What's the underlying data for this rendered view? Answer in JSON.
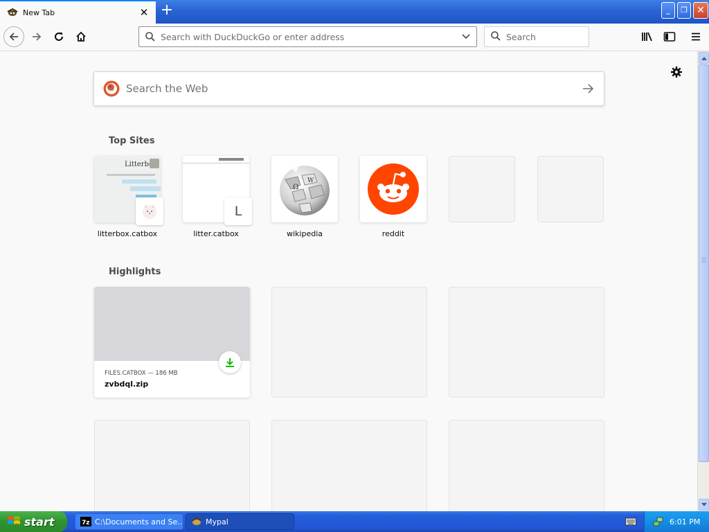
{
  "window": {
    "tab_title": "New Tab",
    "tab_close": "✕",
    "new_tab": "+",
    "minimize": "_",
    "maximize": "❐",
    "close": "✕"
  },
  "toolbar": {
    "url_placeholder": "Search with DuckDuckGo or enter address",
    "search_placeholder": "Search"
  },
  "newtab": {
    "web_search_placeholder": "Search the Web",
    "top_sites_title": "Top Sites",
    "top_sites": [
      {
        "label": "litterbox.catbox",
        "icon": "litterbox-thumbnail"
      },
      {
        "label": "litter.catbox",
        "icon": "letter-L",
        "letter": "L"
      },
      {
        "label": "wikipedia",
        "icon": "wikipedia-globe"
      },
      {
        "label": "reddit",
        "icon": "reddit-alien"
      },
      {
        "label": "",
        "icon": "empty"
      },
      {
        "label": "",
        "icon": "empty"
      }
    ],
    "highlights_title": "Highlights",
    "highlights": [
      {
        "source": "FILES.CATBOX — 186 MB",
        "title": "zvbdql.zip",
        "icon": "download-icon"
      }
    ]
  },
  "taskbar": {
    "start_label": "start",
    "tasks": [
      {
        "label": "C:\\Documents and Se...",
        "icon": "7zip-icon"
      },
      {
        "label": "Mypal",
        "icon": "mypal-icon"
      }
    ],
    "clock": "6:01 PM"
  },
  "colors": {
    "accent": "#0a84ff",
    "reddit": "#ff4500",
    "download_green": "#12bc00",
    "xp_blue": "#245edb",
    "xp_green": "#2f932f"
  }
}
